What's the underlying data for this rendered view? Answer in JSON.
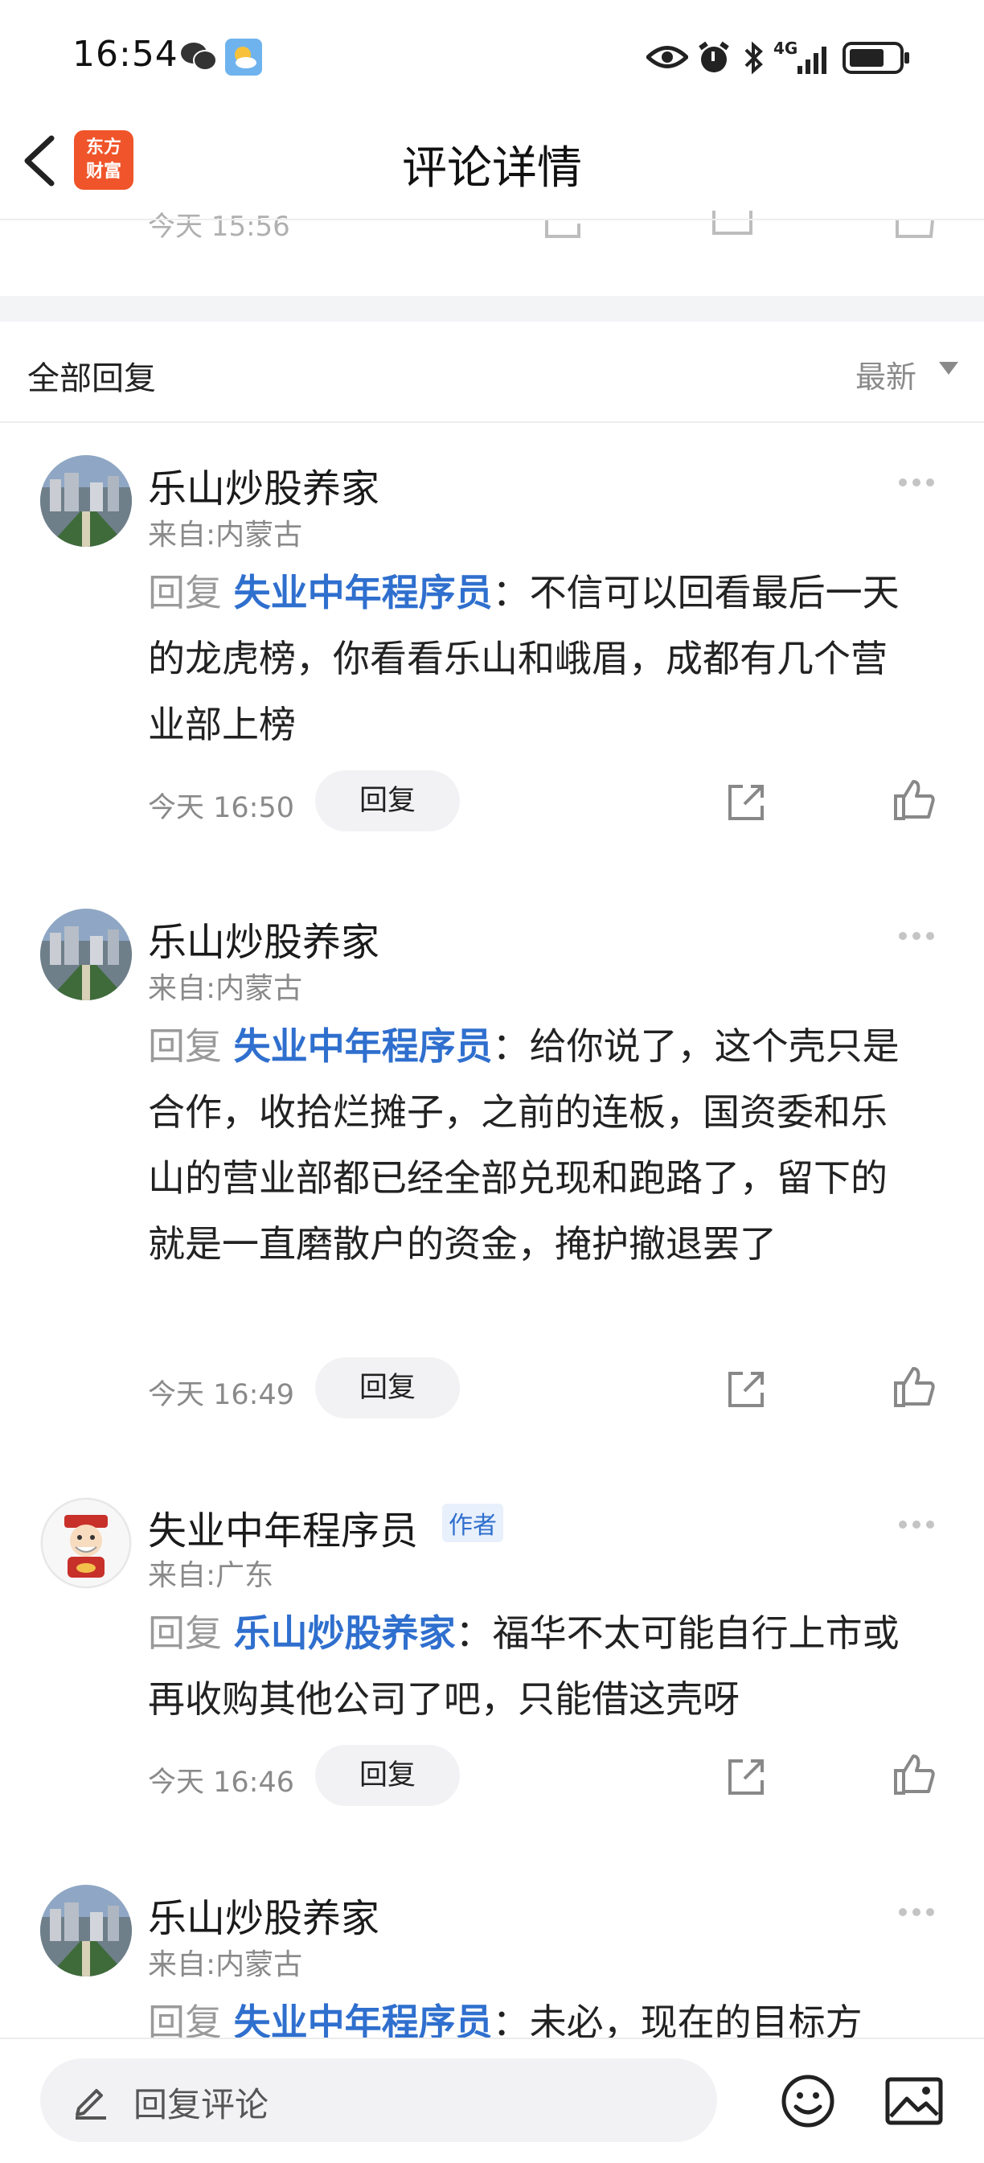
{
  "status_bar": {
    "time": "16:54",
    "network": "4G",
    "icons": [
      "wechat-icon",
      "weather-icon",
      "eye-icon",
      "alarm-icon",
      "bluetooth-icon",
      "signal-icon",
      "battery-icon"
    ]
  },
  "header": {
    "title": "评论详情",
    "logo_line1": "东方",
    "logo_line2": "财富"
  },
  "previous_comment": {
    "time": "今天 15:56"
  },
  "section": {
    "title": "全部回复",
    "sort": "最新"
  },
  "comments": [
    {
      "username": "乐山炒股养家",
      "location": "来自:内蒙古",
      "reply_prefix": "回复 ",
      "reply_to": "失业中年程序员",
      "text": "：不信可以回看最后一天的龙虎榜，你看看乐山和峨眉，成都有几个营业部上榜",
      "time": "今天 16:50",
      "reply_label": "回复"
    },
    {
      "username": "乐山炒股养家",
      "location": "来自:内蒙古",
      "reply_prefix": "回复 ",
      "reply_to": "失业中年程序员",
      "text": "：给你说了，这个壳只是合作，收拾烂摊子，之前的连板，国资委和乐山的营业部都已经全部兑现和跑路了，留下的就是一直磨散户的资金，掩护撤退罢了",
      "time": "今天 16:49",
      "reply_label": "回复"
    },
    {
      "username": "失业中年程序员",
      "badge": "作者",
      "location": "来自:广东",
      "reply_prefix": "回复 ",
      "reply_to": "乐山炒股养家",
      "text": "：福华不太可能自行上市或再收购其他公司了吧，只能借这壳呀",
      "time": "今天 16:46",
      "reply_label": "回复"
    },
    {
      "username": "乐山炒股养家",
      "location": "来自:内蒙古",
      "reply_prefix": "回复 ",
      "reply_to": "失业中年程序员",
      "text": "：未必，现在的目标方"
    }
  ],
  "bottom_bar": {
    "input_placeholder": "回复评论"
  },
  "colors": {
    "accent": "#2f6fce",
    "logo": "#f0542a",
    "muted": "#8a8a8a"
  }
}
